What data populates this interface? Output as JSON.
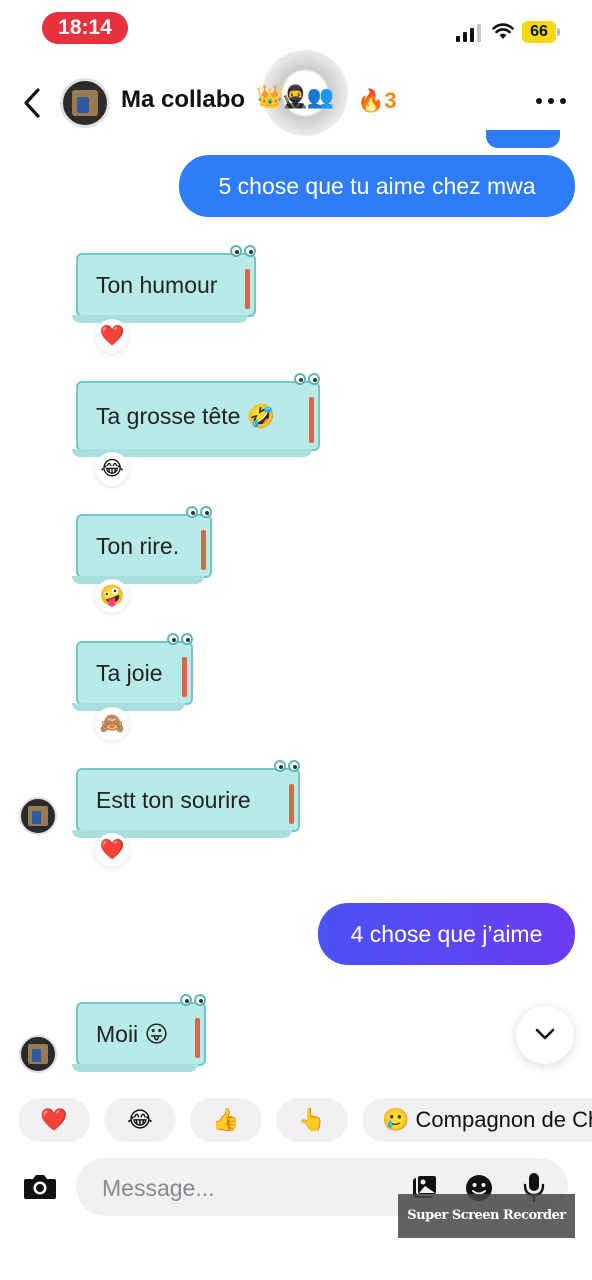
{
  "status_bar": {
    "time": "18:14",
    "battery": "66"
  },
  "header": {
    "title": "Ma collabo",
    "title_emojis": "👑🥷👥",
    "streak": "🔥3"
  },
  "messages": [
    {
      "type": "outgoing",
      "text": "5 chose que tu aime chez mwa"
    },
    {
      "type": "incoming",
      "text": "Ton humour",
      "reaction": "❤️"
    },
    {
      "type": "incoming",
      "text": "Ta grosse tête 🤣",
      "reaction": "😂"
    },
    {
      "type": "incoming",
      "text": "Ton rire.",
      "reaction": "🤪"
    },
    {
      "type": "incoming",
      "text": "Ta joie",
      "reaction": "🙈"
    },
    {
      "type": "incoming",
      "text": "Estt ton sourire",
      "reaction": "❤️"
    },
    {
      "type": "outgoing",
      "text": "4 chose que j’aime"
    },
    {
      "type": "incoming",
      "text": "Moii 😛",
      "reaction": "❤️"
    }
  ],
  "quick_replies": [
    "❤️",
    "😂",
    "👍",
    "👆",
    "Compagnon de Ch"
  ],
  "quick_reply_prefix_emoji": "🥲",
  "composer": {
    "placeholder": "Message..."
  },
  "watermark": "Super Screen Recorder",
  "colors": {
    "outgoing_blue": "#2e7cf6",
    "outgoing_violet": "#6a3cf2",
    "dino_fill": "#b8eae8",
    "time_pill": "#e5323e",
    "battery": "#f5d90a"
  }
}
